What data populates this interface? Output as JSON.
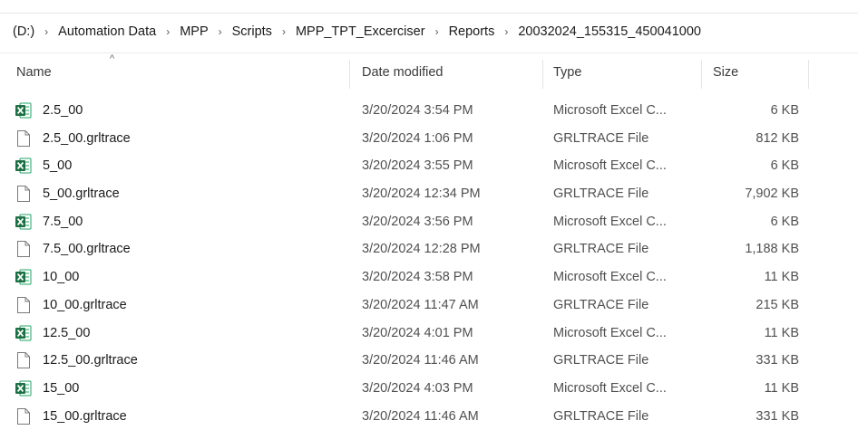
{
  "breadcrumb": [
    "(D:)",
    "Automation Data",
    "MPP",
    "Scripts",
    "MPP_TPT_Excerciser",
    "Reports",
    "20032024_155315_450041000"
  ],
  "columns": {
    "name": "Name",
    "date": "Date modified",
    "type": "Type",
    "size": "Size"
  },
  "sort_indicator": "^",
  "files": [
    {
      "name": "2.5_00",
      "date": "3/20/2024 3:54 PM",
      "type": "Microsoft Excel C...",
      "size": "6 KB",
      "icon": "excel-icon"
    },
    {
      "name": "2.5_00.grltrace",
      "date": "3/20/2024 1:06 PM",
      "type": "GRLTRACE File",
      "size": "812 KB",
      "icon": "file-icon"
    },
    {
      "name": "5_00",
      "date": "3/20/2024 3:55 PM",
      "type": "Microsoft Excel C...",
      "size": "6 KB",
      "icon": "excel-icon"
    },
    {
      "name": "5_00.grltrace",
      "date": "3/20/2024 12:34 PM",
      "type": "GRLTRACE File",
      "size": "7,902 KB",
      "icon": "file-icon"
    },
    {
      "name": "7.5_00",
      "date": "3/20/2024 3:56 PM",
      "type": "Microsoft Excel C...",
      "size": "6 KB",
      "icon": "excel-icon"
    },
    {
      "name": "7.5_00.grltrace",
      "date": "3/20/2024 12:28 PM",
      "type": "GRLTRACE File",
      "size": "1,188 KB",
      "icon": "file-icon"
    },
    {
      "name": "10_00",
      "date": "3/20/2024 3:58 PM",
      "type": "Microsoft Excel C...",
      "size": "11 KB",
      "icon": "excel-icon"
    },
    {
      "name": "10_00.grltrace",
      "date": "3/20/2024 11:47 AM",
      "type": "GRLTRACE File",
      "size": "215 KB",
      "icon": "file-icon"
    },
    {
      "name": "12.5_00",
      "date": "3/20/2024 4:01 PM",
      "type": "Microsoft Excel C...",
      "size": "11 KB",
      "icon": "excel-icon"
    },
    {
      "name": "12.5_00.grltrace",
      "date": "3/20/2024 11:46 AM",
      "type": "GRLTRACE File",
      "size": "331 KB",
      "icon": "file-icon"
    },
    {
      "name": "15_00",
      "date": "3/20/2024 4:03 PM",
      "type": "Microsoft Excel C...",
      "size": "11 KB",
      "icon": "excel-icon"
    },
    {
      "name": "15_00.grltrace",
      "date": "3/20/2024 11:46 AM",
      "type": "GRLTRACE File",
      "size": "331 KB",
      "icon": "file-icon"
    }
  ],
  "colors": {
    "excel_green": "#1d7044",
    "excel_dark": "#185c37",
    "hover": "#e5f3ff"
  }
}
